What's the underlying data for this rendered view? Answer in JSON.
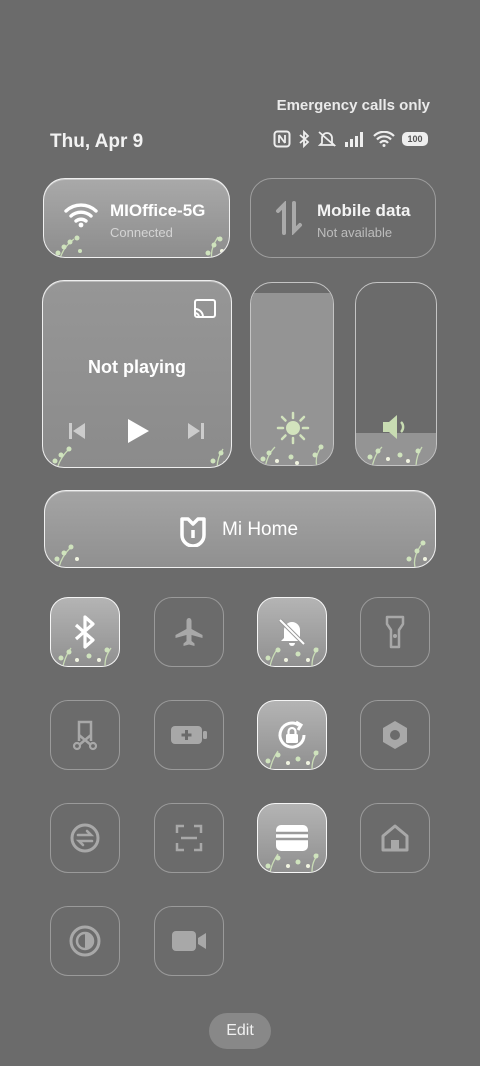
{
  "status": {
    "carrier_text": "Emergency calls only",
    "date": "Thu, Apr 9",
    "battery_level": "100",
    "icons": [
      "nfc-icon",
      "bluetooth-icon",
      "mute-icon",
      "signal-icon",
      "wifi-icon",
      "battery-icon"
    ]
  },
  "wifi": {
    "title": "MIOffice-5G",
    "subtitle": "Connected",
    "active": true
  },
  "mobile_data": {
    "title": "Mobile data",
    "subtitle": "Not available",
    "active": false
  },
  "media": {
    "status": "Not playing"
  },
  "mi_home": {
    "label": "Mi Home"
  },
  "toggles": [
    {
      "name": "bluetooth",
      "on": true
    },
    {
      "name": "airplane-mode",
      "on": false
    },
    {
      "name": "mute",
      "on": true
    },
    {
      "name": "flashlight",
      "on": false
    },
    {
      "name": "screenshot",
      "on": false
    },
    {
      "name": "battery-saver",
      "on": false
    },
    {
      "name": "rotation-lock",
      "on": true
    },
    {
      "name": "settings",
      "on": false
    },
    {
      "name": "sync",
      "on": false
    },
    {
      "name": "scanner",
      "on": false
    },
    {
      "name": "card-wallet",
      "on": true
    },
    {
      "name": "home",
      "on": false
    },
    {
      "name": "reading-mode",
      "on": false
    },
    {
      "name": "screen-recorder",
      "on": false
    }
  ],
  "edit_label": "Edit"
}
